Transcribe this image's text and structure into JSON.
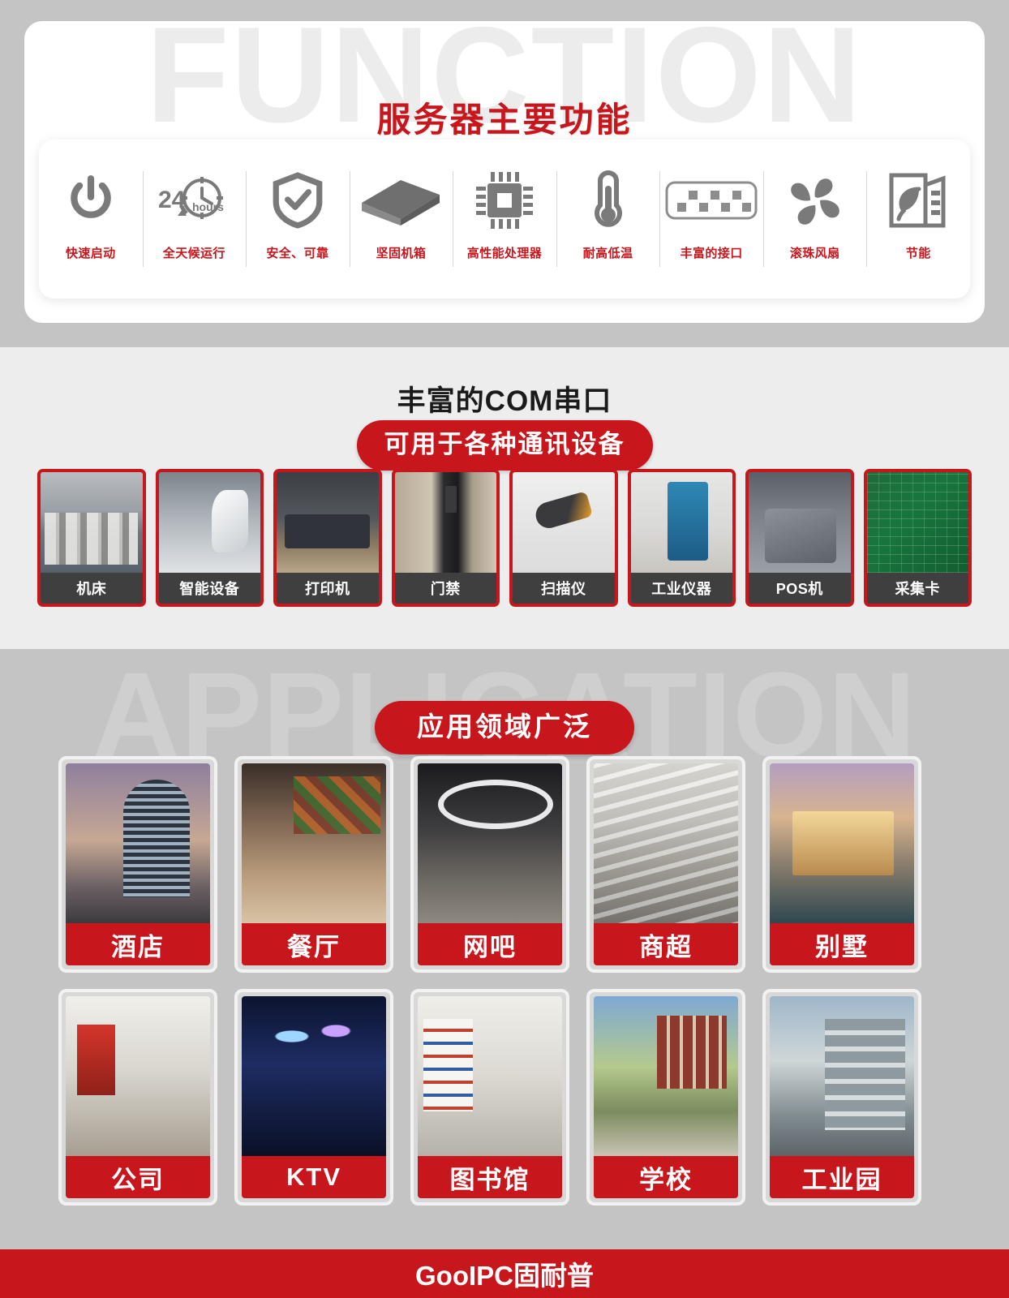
{
  "function_section": {
    "watermark": "FUNCTION",
    "title": "服务器主要功能",
    "features": [
      {
        "icon": "power-icon",
        "label": "快速启动"
      },
      {
        "icon": "24hours-clock-icon",
        "label": "全天候运行"
      },
      {
        "icon": "shield-check-icon",
        "label": "安全、可靠"
      },
      {
        "icon": "chassis-box-icon",
        "label": "坚固机箱"
      },
      {
        "icon": "cpu-chip-icon",
        "label": "高性能处理器"
      },
      {
        "icon": "thermometer-icon",
        "label": "耐高低温"
      },
      {
        "icon": "io-ports-icon",
        "label": "丰富的接口"
      },
      {
        "icon": "fan-icon",
        "label": "滚珠风扇"
      },
      {
        "icon": "eco-leaf-building-icon",
        "label": "节能"
      }
    ]
  },
  "com_section": {
    "title": "丰富的COM串口",
    "subtitle": "可用于各种通讯设备",
    "devices": [
      {
        "label": "机床",
        "photo": "ph-machine"
      },
      {
        "label": "智能设备",
        "photo": "ph-robot"
      },
      {
        "label": "打印机",
        "photo": "ph-printer"
      },
      {
        "label": "门禁",
        "photo": "ph-door"
      },
      {
        "label": "扫描仪",
        "photo": "ph-scanner"
      },
      {
        "label": "工业仪器",
        "photo": "ph-kiosk"
      },
      {
        "label": "POS机",
        "photo": "ph-pos"
      },
      {
        "label": "采集卡",
        "photo": "ph-pcb"
      }
    ]
  },
  "application_section": {
    "watermark": "APPLICATION",
    "pill_title": "应用领域广泛",
    "applications": [
      {
        "label": "酒店",
        "photo": "ph-hotel"
      },
      {
        "label": "餐厅",
        "photo": "ph-rest"
      },
      {
        "label": "网吧",
        "photo": "ph-cafe"
      },
      {
        "label": "商超",
        "photo": "ph-mall"
      },
      {
        "label": "别墅",
        "photo": "ph-villa"
      },
      {
        "label": "公司",
        "photo": "ph-office"
      },
      {
        "label": "KTV",
        "photo": "ph-ktv"
      },
      {
        "label": "图书馆",
        "photo": "ph-lib"
      },
      {
        "label": "学校",
        "photo": "ph-school"
      },
      {
        "label": "工业园",
        "photo": "ph-indpark"
      }
    ]
  },
  "footer": {
    "logo_text": "GooIPC固耐普"
  },
  "colors": {
    "brand_red": "#c8161d",
    "dark_caption": "#3f3f3f",
    "section_gray": "#c4c4c4",
    "section_light": "#ededed",
    "icon_gray": "#7a7a7a"
  }
}
